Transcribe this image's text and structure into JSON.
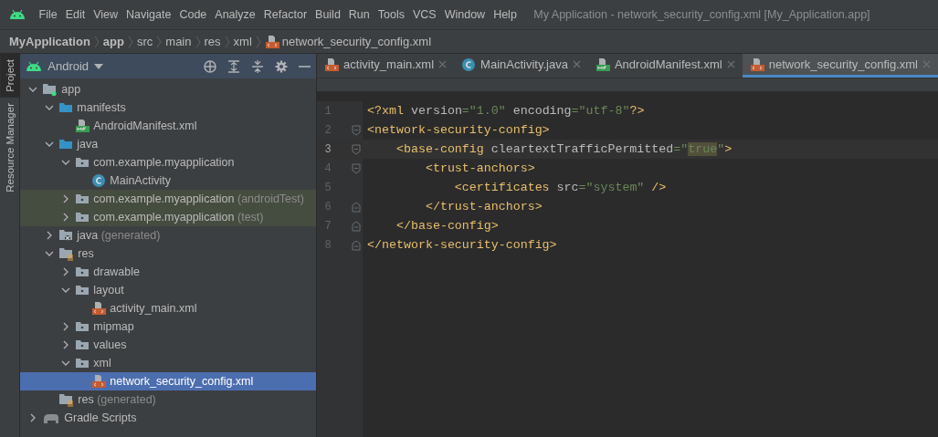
{
  "menu": [
    {
      "label": "File"
    },
    {
      "label": "Edit"
    },
    {
      "label": "View"
    },
    {
      "label": "Navigate"
    },
    {
      "label": "Code"
    },
    {
      "label": "Analyze"
    },
    {
      "label": "Refactor"
    },
    {
      "label": "Build"
    },
    {
      "label": "Run"
    },
    {
      "label": "Tools"
    },
    {
      "label": "VCS"
    },
    {
      "label": "Window"
    },
    {
      "label": "Help"
    }
  ],
  "window": {
    "title": "My Application - network_security_config.xml [My_Application.app]"
  },
  "breadcrumb": [
    {
      "label": "MyApplication",
      "bold": true,
      "kind": "dir"
    },
    {
      "label": "app",
      "bold": true,
      "kind": "dir"
    },
    {
      "label": "src",
      "bold": false,
      "kind": "dir"
    },
    {
      "label": "main",
      "bold": false,
      "kind": "dir"
    },
    {
      "label": "res",
      "bold": false,
      "kind": "dir"
    },
    {
      "label": "xml",
      "bold": false,
      "kind": "dir"
    },
    {
      "label": "network_security_config.xml",
      "bold": false,
      "kind": "xml"
    }
  ],
  "side_tabs": [
    {
      "label": "Project",
      "selected": true
    },
    {
      "label": "Resource Manager",
      "selected": false
    }
  ],
  "project_panel": {
    "view": "Android"
  },
  "tree": [
    {
      "label": "app",
      "kind": "module",
      "expanded": true,
      "selected": false,
      "tinted": false,
      "children": [
        {
          "label": "manifests",
          "kind": "folder",
          "expanded": true,
          "selected": false,
          "tinted": false,
          "children": [
            {
              "label": "AndroidManifest.xml",
              "kind": "manifest",
              "selected": false,
              "tinted": false
            }
          ]
        },
        {
          "label": "java",
          "kind": "folder",
          "expanded": true,
          "selected": false,
          "tinted": false,
          "children": [
            {
              "label": "com.example.myapplication",
              "kind": "package",
              "expanded": true,
              "selected": false,
              "tinted": false,
              "children": [
                {
                  "label": "MainActivity",
                  "kind": "class",
                  "selected": false,
                  "tinted": false
                }
              ]
            },
            {
              "label": "com.example.myapplication",
              "suffix": "(androidTest)",
              "kind": "package",
              "expanded": false,
              "selected": false,
              "tinted": true
            },
            {
              "label": "com.example.myapplication",
              "suffix": "(test)",
              "kind": "package",
              "expanded": false,
              "selected": false,
              "tinted": true
            }
          ]
        },
        {
          "label": "java",
          "suffix": "(generated)",
          "kind": "generated",
          "expanded": false,
          "selected": false,
          "tinted": false
        },
        {
          "label": "res",
          "kind": "res",
          "expanded": true,
          "selected": false,
          "tinted": false,
          "children": [
            {
              "label": "drawable",
              "kind": "package",
              "expanded": false,
              "selected": false,
              "tinted": false
            },
            {
              "label": "layout",
              "kind": "package",
              "expanded": true,
              "selected": false,
              "tinted": false,
              "children": [
                {
                  "label": "activity_main.xml",
                  "kind": "xml",
                  "selected": false,
                  "tinted": false
                }
              ]
            },
            {
              "label": "mipmap",
              "kind": "package",
              "expanded": false,
              "selected": false,
              "tinted": false
            },
            {
              "label": "values",
              "kind": "package",
              "expanded": false,
              "selected": false,
              "tinted": false
            },
            {
              "label": "xml",
              "kind": "package",
              "expanded": true,
              "selected": false,
              "tinted": false,
              "children": [
                {
                  "label": "network_security_config.xml",
                  "kind": "xml",
                  "selected": true,
                  "tinted": false
                }
              ]
            }
          ]
        },
        {
          "label": "res",
          "suffix": "(generated)",
          "kind": "res",
          "selected": false,
          "tinted": false
        }
      ]
    },
    {
      "label": "Gradle Scripts",
      "kind": "gradle",
      "expanded": false,
      "selected": false,
      "tinted": false
    }
  ],
  "editor_tabs": [
    {
      "label": "activity_main.xml",
      "kind": "xml",
      "selected": false
    },
    {
      "label": "MainActivity.java",
      "kind": "class",
      "selected": false
    },
    {
      "label": "AndroidManifest.xml",
      "kind": "manifest",
      "selected": false
    },
    {
      "label": "network_security_config.xml",
      "kind": "xml",
      "selected": true
    }
  ],
  "code_lines": [
    {
      "number": "1",
      "current": false,
      "kind": "plain",
      "tokens": [
        {
          "kind": "tag",
          "text": "<?xml "
        },
        {
          "kind": "attr",
          "text": "version"
        },
        {
          "kind": "value",
          "text": "=\"1.0\" "
        },
        {
          "kind": "attr",
          "text": "encoding"
        },
        {
          "kind": "value",
          "text": "=\"utf-8\""
        },
        {
          "kind": "tag",
          "text": "?>"
        }
      ]
    },
    {
      "number": "2",
      "current": false,
      "kind": "fold_start",
      "tokens": [
        {
          "kind": "tag",
          "text": "<network-security-config>"
        }
      ]
    },
    {
      "number": "3",
      "current": true,
      "kind": "fold_start",
      "tokens": [
        {
          "kind": "tag",
          "text": "    <base-config "
        },
        {
          "kind": "attr",
          "text": "cleartextTrafficPermitted"
        },
        {
          "kind": "value",
          "text": "=\""
        },
        {
          "kind": "match",
          "text": "true"
        },
        {
          "kind": "value",
          "text": "\""
        },
        {
          "kind": "tag",
          "text": ">"
        }
      ]
    },
    {
      "number": "4",
      "current": false,
      "kind": "fold_start",
      "tokens": [
        {
          "kind": "tag",
          "text": "        <trust-anchors>"
        }
      ]
    },
    {
      "number": "5",
      "current": false,
      "kind": "plain",
      "tokens": [
        {
          "kind": "tag",
          "text": "            <certificates "
        },
        {
          "kind": "attr",
          "text": "src"
        },
        {
          "kind": "value",
          "text": "=\"system\" "
        },
        {
          "kind": "tag",
          "text": "/>"
        }
      ]
    },
    {
      "number": "6",
      "current": false,
      "kind": "fold_end",
      "tokens": [
        {
          "kind": "tag",
          "text": "        </trust-anchors>"
        }
      ]
    },
    {
      "number": "7",
      "current": false,
      "kind": "fold_end",
      "tokens": [
        {
          "kind": "tag",
          "text": "    </base-config>"
        }
      ]
    },
    {
      "number": "8",
      "current": false,
      "kind": "fold_end",
      "tokens": [
        {
          "kind": "tag",
          "text": "</network-security-config>"
        }
      ]
    }
  ]
}
